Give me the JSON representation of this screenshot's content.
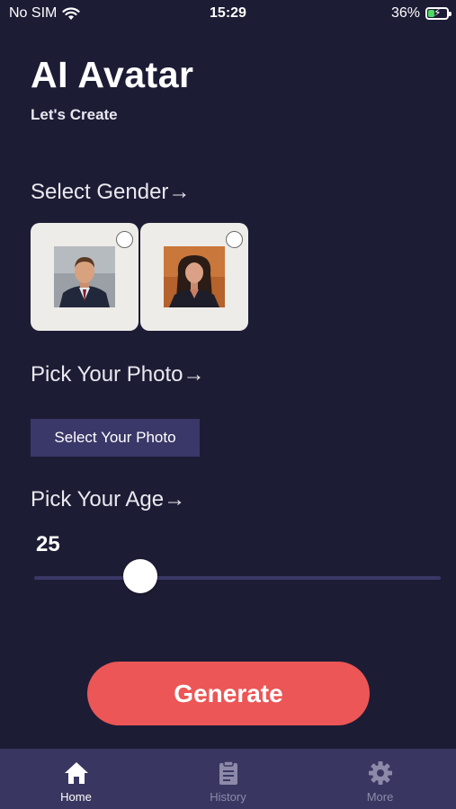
{
  "status_bar": {
    "carrier": "No SIM",
    "time": "15:29",
    "battery": "36%",
    "battery_level": 0.36
  },
  "header": {
    "title": "AI Avatar",
    "subtitle": "Let's Create"
  },
  "gender": {
    "label": "Select Gender→",
    "options": [
      {
        "name": "male",
        "icon": "male-avatar-photo",
        "selected": false
      },
      {
        "name": "female",
        "icon": "female-avatar-photo",
        "selected": false
      }
    ]
  },
  "photo": {
    "label": "Pick Your Photo→",
    "button_label": "Select Your Photo"
  },
  "age": {
    "label": "Pick Your Age→",
    "value": "25",
    "slider_fraction": 0.26
  },
  "generate": {
    "label": "Generate"
  },
  "tabs": [
    {
      "label": "Home",
      "icon": "home-icon",
      "active": true
    },
    {
      "label": "History",
      "icon": "history-clipboard-icon",
      "active": false
    },
    {
      "label": "More",
      "icon": "gear-icon",
      "active": false
    }
  ],
  "colors": {
    "background": "#1d1c35",
    "accent": "#ec5656",
    "button": "#3a3868",
    "tab_bar": "#393761",
    "tab_active": "#ffffff",
    "tab_inactive": "#8c8aa8"
  }
}
